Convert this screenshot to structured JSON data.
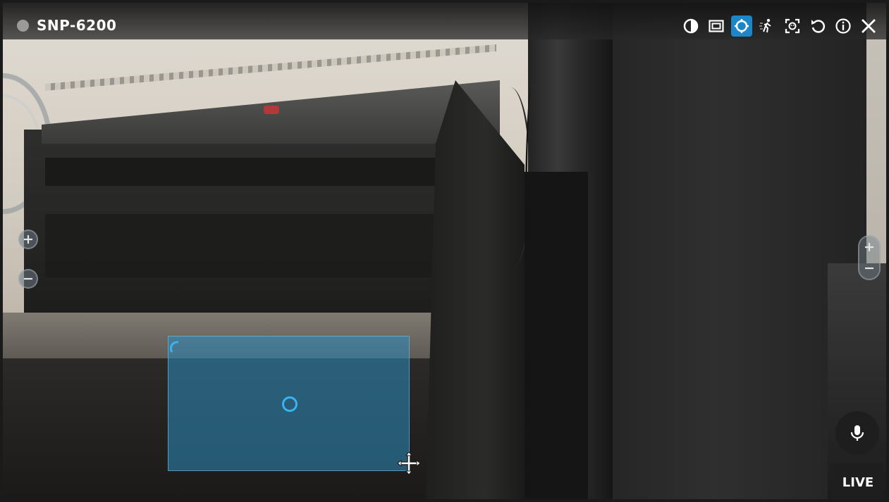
{
  "camera": {
    "name": "SNP-6200",
    "status_color": "#9a9a9a"
  },
  "toolbar": {
    "accent_color": "#1d86c8",
    "buttons": [
      {
        "icon": "contrast-icon",
        "active": false
      },
      {
        "icon": "picture-in-picture-icon",
        "active": false
      },
      {
        "icon": "area-zoom-icon",
        "active": true
      },
      {
        "icon": "motion-detection-icon",
        "active": false
      },
      {
        "icon": "face-detection-icon",
        "active": false
      },
      {
        "icon": "rotate-icon",
        "active": false
      },
      {
        "icon": "info-icon",
        "active": false
      },
      {
        "icon": "close-icon",
        "active": false
      }
    ]
  },
  "zoom_controls": {
    "left": [
      "zoom-in-icon",
      "zoom-out-icon"
    ],
    "right": [
      "zoom-in-icon",
      "zoom-out-icon"
    ]
  },
  "roi": {
    "color": "#2c8cbe"
  },
  "audio": {
    "icon": "microphone-icon"
  },
  "status": {
    "live_label": "LIVE"
  }
}
